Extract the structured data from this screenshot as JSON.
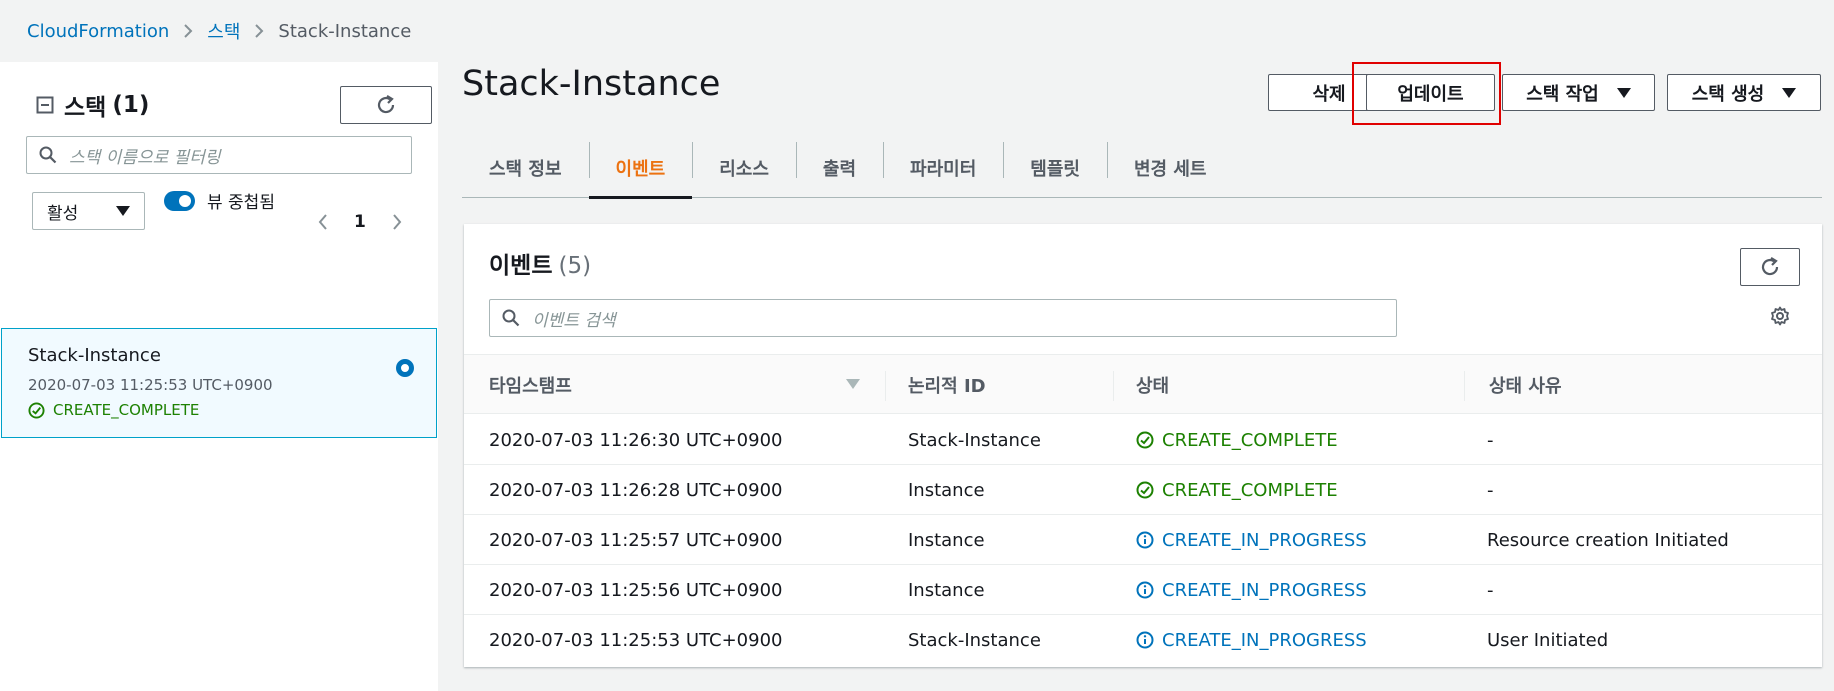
{
  "breadcrumb": {
    "items": [
      "CloudFormation",
      "스택",
      "Stack-Instance"
    ]
  },
  "left_panel": {
    "title": "스택",
    "count": "(1)",
    "search_placeholder": "스택 이름으로 필터링",
    "filter_select": "활성",
    "toggle_label": "뷰 중첩됨",
    "page": "1",
    "stack": {
      "name": "Stack-Instance",
      "date": "2020-07-03 11:25:53 UTC+0900",
      "status": "CREATE_COMPLETE"
    }
  },
  "header": {
    "title": "Stack-Instance",
    "delete_label": "삭제",
    "update_label": "업데이트",
    "stack_actions_label": "스택 작업",
    "create_stack_label": "스택 생성"
  },
  "tabs": [
    {
      "label": "스택 정보",
      "active": false
    },
    {
      "label": "이벤트",
      "active": true
    },
    {
      "label": "리소스",
      "active": false
    },
    {
      "label": "출력",
      "active": false
    },
    {
      "label": "파라미터",
      "active": false
    },
    {
      "label": "템플릿",
      "active": false
    },
    {
      "label": "변경 세트",
      "active": false
    }
  ],
  "events": {
    "title": "이벤트",
    "count": "(5)",
    "search_placeholder": "이벤트 검색",
    "columns": [
      "타임스탬프",
      "논리적 ID",
      "상태",
      "상태 사유"
    ],
    "rows": [
      {
        "timestamp": "2020-07-03 11:26:30 UTC+0900",
        "logical_id": "Stack-Instance",
        "status": "CREATE_COMPLETE",
        "reason": "-"
      },
      {
        "timestamp": "2020-07-03 11:26:28 UTC+0900",
        "logical_id": "Instance",
        "status": "CREATE_COMPLETE",
        "reason": "-"
      },
      {
        "timestamp": "2020-07-03 11:25:57 UTC+0900",
        "logical_id": "Instance",
        "status": "CREATE_IN_PROGRESS",
        "reason": "Resource creation Initiated"
      },
      {
        "timestamp": "2020-07-03 11:25:56 UTC+0900",
        "logical_id": "Instance",
        "status": "CREATE_IN_PROGRESS",
        "reason": "-"
      },
      {
        "timestamp": "2020-07-03 11:25:53 UTC+0900",
        "logical_id": "Stack-Instance",
        "status": "CREATE_IN_PROGRESS",
        "reason": "User Initiated"
      }
    ]
  },
  "colors": {
    "link": "#0073bb",
    "success": "#1d8102",
    "in_progress": "#0073bb",
    "active_tab": "#ec7211",
    "highlight": "#e00000"
  },
  "icons": {
    "collapse": "minus-square-icon",
    "refresh": "refresh-icon",
    "search": "search-icon",
    "caret": "caret-down-icon",
    "chevron_left": "chevron-left-icon",
    "chevron_right": "chevron-right-icon",
    "success": "check-circle-icon",
    "info": "info-circle-icon",
    "settings": "gear-icon"
  }
}
